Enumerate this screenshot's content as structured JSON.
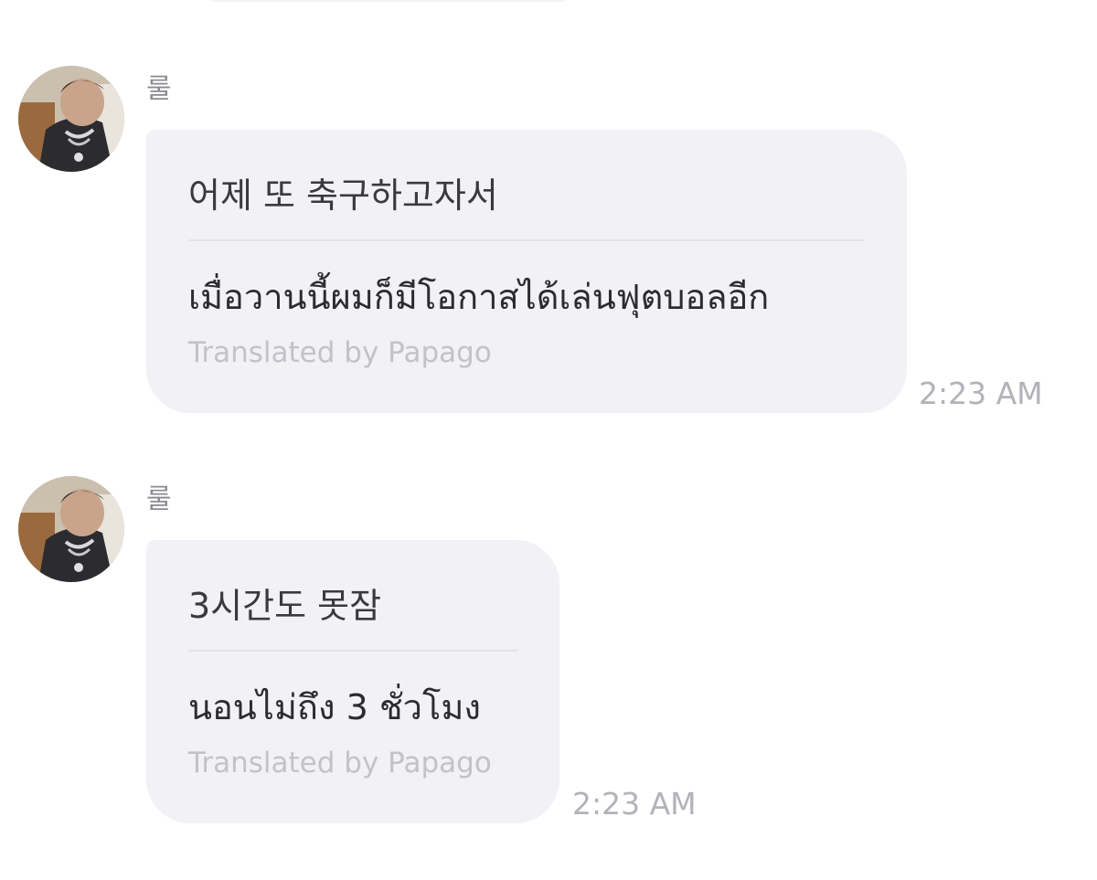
{
  "messages": [
    {
      "sender": "룰",
      "avatar_icon": "user-avatar",
      "original": "어제 또 축구하고자서",
      "translation": "เมื่อวานนี้ผมก็มีโอกาสได้เล่นฟุตบอลอีก",
      "credit": "Translated by Papago",
      "time": "2:23 AM"
    },
    {
      "sender": "룰",
      "avatar_icon": "user-avatar",
      "original": "3시간도 못잠",
      "translation": "นอนไม่ถึง 3 ชั่วโมง",
      "credit": "Translated by Papago",
      "time": "2:23 AM"
    }
  ],
  "colors": {
    "bubble": "#f1f1f6",
    "divider": "#e2e2e8",
    "credit": "#c2c2c8",
    "timestamp": "#b2b2b8"
  }
}
